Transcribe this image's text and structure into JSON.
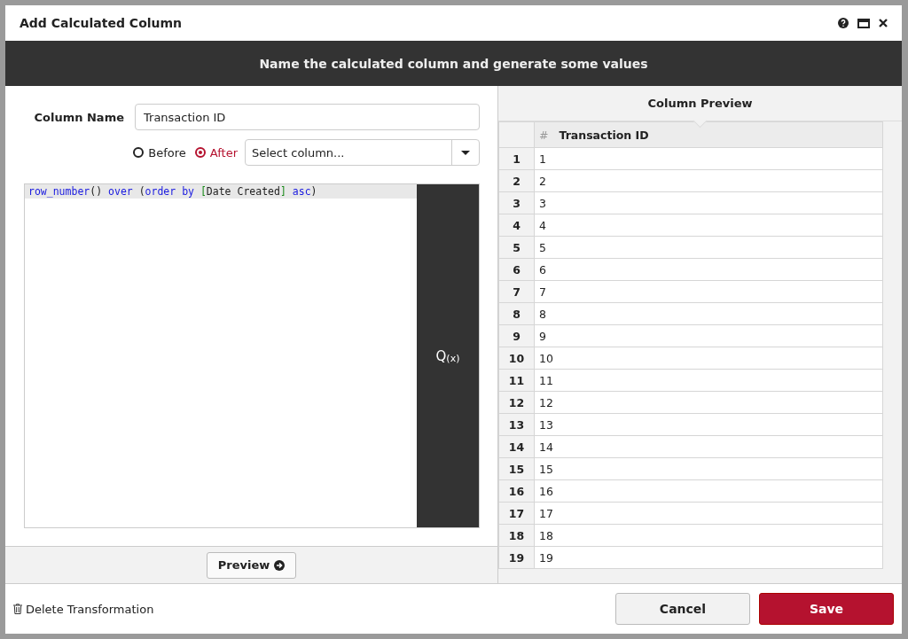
{
  "dialog": {
    "title": "Add Calculated Column"
  },
  "banner": "Name the calculated column and generate some values",
  "form": {
    "column_name_label": "Column Name",
    "column_name_value": "Transaction ID",
    "position": [
      {
        "label": "Before",
        "selected": false
      },
      {
        "label": "After",
        "selected": true
      }
    ],
    "column_select": {
      "placeholder": "Select column..."
    },
    "code": [
      {
        "text": "row_number",
        "kind": "keyword"
      },
      {
        "text": "() ",
        "kind": "plain"
      },
      {
        "text": "over",
        "kind": "keyword"
      },
      {
        "text": " (",
        "kind": "plain"
      },
      {
        "text": "order by",
        "kind": "keyword"
      },
      {
        "text": " [",
        "kind": "bracket"
      },
      {
        "text": "Date Created",
        "kind": "plain"
      },
      {
        "text": "]",
        "kind": "bracket"
      },
      {
        "text": " asc",
        "kind": "keyword"
      },
      {
        "text": ")",
        "kind": "plain"
      }
    ],
    "function_button": "Q$_{(x)}$",
    "preview_button": "Preview"
  },
  "preview": {
    "title": "Column Preview",
    "type_marker": "#",
    "column": "Transaction ID",
    "rows": [
      {
        "index": "1",
        "value": "1"
      },
      {
        "index": "2",
        "value": "2"
      },
      {
        "index": "3",
        "value": "3"
      },
      {
        "index": "4",
        "value": "4"
      },
      {
        "index": "5",
        "value": "5"
      },
      {
        "index": "6",
        "value": "6"
      },
      {
        "index": "7",
        "value": "7"
      },
      {
        "index": "8",
        "value": "8"
      },
      {
        "index": "9",
        "value": "9"
      },
      {
        "index": "10",
        "value": "10"
      },
      {
        "index": "11",
        "value": "11"
      },
      {
        "index": "12",
        "value": "12"
      },
      {
        "index": "13",
        "value": "13"
      },
      {
        "index": "14",
        "value": "14"
      },
      {
        "index": "15",
        "value": "15"
      },
      {
        "index": "16",
        "value": "16"
      },
      {
        "index": "17",
        "value": "17"
      },
      {
        "index": "18",
        "value": "18"
      },
      {
        "index": "19",
        "value": "19"
      }
    ]
  },
  "footer": {
    "delete_link": "Delete Transformation",
    "cancel": "Cancel",
    "save": "Save"
  }
}
